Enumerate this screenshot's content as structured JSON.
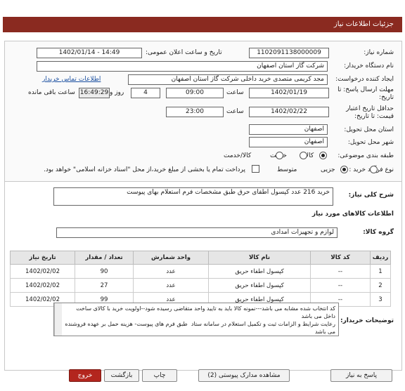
{
  "header": {
    "title": "جزئیات اطلاعات نیاز"
  },
  "form": {
    "need_number_label": "شماره نیاز:",
    "need_number": "1102091138000009",
    "announce_label": "تاریخ و ساعت اعلان عمومی:",
    "announce_value": "1402/01/14 - 14:49",
    "buyer_label": "نام دستگاه خریدار:",
    "buyer": "شرکت گاز استان اصفهان",
    "creator_label": "ایجاد کننده درخواست:",
    "creator": "مجد کریمی متصدی خرید داخلی شرکت گاز استان اصفهان",
    "contact_link": "اطلاعات تماس خریدار",
    "deadline_label": "مهلت ارسال پاسخ: تا تاریخ:",
    "deadline_date": "1402/01/19",
    "time_label": "ساعت",
    "deadline_time": "09:00",
    "days": "4",
    "days_label": "روز و",
    "remaining_time": "16:49:29",
    "remaining_label": "ساعت باقی مانده",
    "validity_label": "حداقل تاریخ اعتبار قیمت: تا تاریخ:",
    "validity_date": "1402/02/22",
    "validity_time": "23:00",
    "province_label": "استان محل تحویل:",
    "province": "اصفهان",
    "city_label": "شهر محل تحویل:",
    "city": "اصفهان",
    "category_label": "طبقه بندی موضوعی:",
    "cat_goods": "کالا",
    "cat_service": "خدمت",
    "cat_both": "کالا/خدمت",
    "process_label": "نوع فرآیند خرید :",
    "proc_partial": "جزیی",
    "proc_medium": "متوسط",
    "payment_note": "پرداخت تمام یا بخشی از مبلغ خرید،از محل \"اسناد خزانه اسلامی\" خواهد بود."
  },
  "need": {
    "summary_label": "شرح کلی نیاز:",
    "summary": "خرید 216 عدد کپسول اطفای حرق طبق مشخصات فرم استعلام بهای پیوست",
    "goods_info_title": "اطلاعات کالاهای مورد نیاز",
    "group_label": "گروه کالا:",
    "group": "لوازم و تجهیزات امدادی"
  },
  "table": {
    "headers": [
      "ردیف",
      "کد کالا",
      "نام کالا",
      "واحد شمارش",
      "تعداد / مقدار",
      "تاریخ نیاز"
    ],
    "rows": [
      {
        "idx": "1",
        "code": "--",
        "name": "کپسول اطفاء حریق",
        "unit": "عدد",
        "qty": "90",
        "date": "1402/02/02"
      },
      {
        "idx": "2",
        "code": "--",
        "name": "کپسول اطفاء حریق",
        "unit": "عدد",
        "qty": "27",
        "date": "1402/02/02"
      },
      {
        "idx": "3",
        "code": "--",
        "name": "کپسول اطفاء حریق",
        "unit": "عدد",
        "qty": "99",
        "date": "1402/02/02"
      }
    ]
  },
  "buyer_notes": {
    "label": "توضیحات خریدار:",
    "text": "کد انتخاب شده مشابه می باشد---نمونه کالا باید به تایید واحد متقاضی رسیده شود--اولویت خرید با کالای ساخت داخل می باشد\nرعایت شرایط و الزامات ثبت و تکمیل استعلام در سامانه ستاد  طبق فرم های پیوست- هزینه حمل بر عهده فروشنده می باشد"
  },
  "buttons": {
    "reply": "پاسخ به نیاز",
    "attachments": "مشاهده مدارک پیوستی (2)",
    "print": "چاپ",
    "back": "بازگشت",
    "exit": "خروج"
  }
}
